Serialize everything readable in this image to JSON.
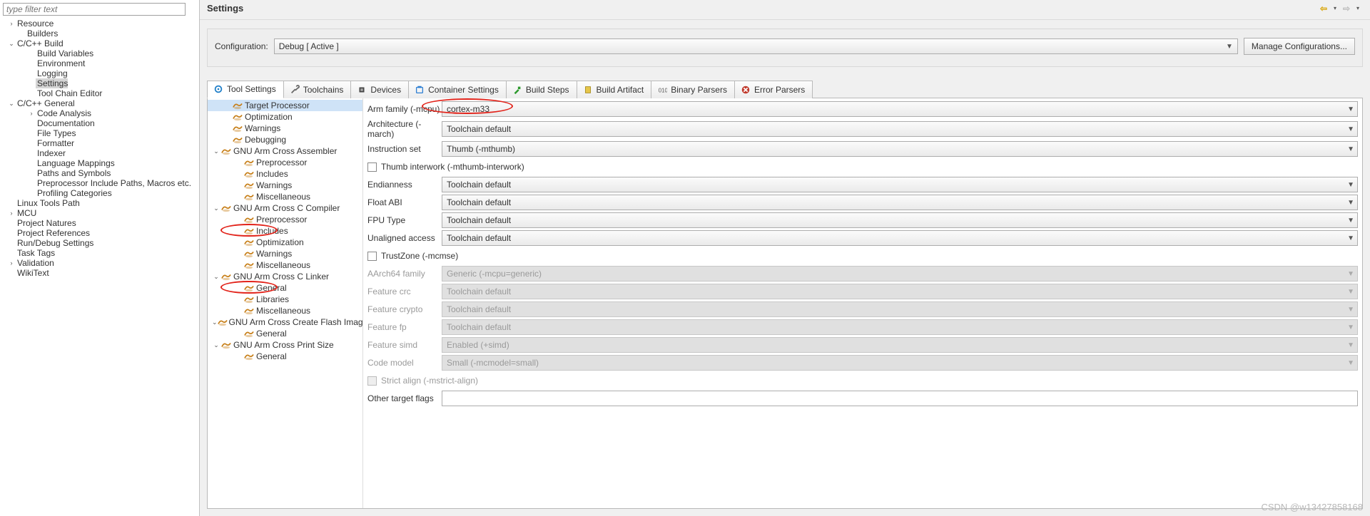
{
  "filter_placeholder": "type filter text",
  "nav": {
    "items": [
      {
        "label": "Resource",
        "indent": 0,
        "tw": ">"
      },
      {
        "label": "Builders",
        "indent": 1,
        "tw": ""
      },
      {
        "label": "C/C++ Build",
        "indent": 0,
        "tw": "v"
      },
      {
        "label": "Build Variables",
        "indent": 2,
        "tw": ""
      },
      {
        "label": "Environment",
        "indent": 2,
        "tw": ""
      },
      {
        "label": "Logging",
        "indent": 2,
        "tw": ""
      },
      {
        "label": "Settings",
        "indent": 2,
        "tw": "",
        "selected": true
      },
      {
        "label": "Tool Chain Editor",
        "indent": 2,
        "tw": ""
      },
      {
        "label": "C/C++ General",
        "indent": 0,
        "tw": "v"
      },
      {
        "label": "Code Analysis",
        "indent": 2,
        "tw": ">"
      },
      {
        "label": "Documentation",
        "indent": 2,
        "tw": ""
      },
      {
        "label": "File Types",
        "indent": 2,
        "tw": ""
      },
      {
        "label": "Formatter",
        "indent": 2,
        "tw": ""
      },
      {
        "label": "Indexer",
        "indent": 2,
        "tw": ""
      },
      {
        "label": "Language Mappings",
        "indent": 2,
        "tw": ""
      },
      {
        "label": "Paths and Symbols",
        "indent": 2,
        "tw": ""
      },
      {
        "label": "Preprocessor Include Paths, Macros etc.",
        "indent": 2,
        "tw": ""
      },
      {
        "label": "Profiling Categories",
        "indent": 2,
        "tw": ""
      },
      {
        "label": "Linux Tools Path",
        "indent": 0,
        "tw": ""
      },
      {
        "label": "MCU",
        "indent": 0,
        "tw": ">"
      },
      {
        "label": "Project Natures",
        "indent": 0,
        "tw": ""
      },
      {
        "label": "Project References",
        "indent": 0,
        "tw": ""
      },
      {
        "label": "Run/Debug Settings",
        "indent": 0,
        "tw": ""
      },
      {
        "label": "Task Tags",
        "indent": 0,
        "tw": ""
      },
      {
        "label": "Validation",
        "indent": 0,
        "tw": ">"
      },
      {
        "label": "WikiText",
        "indent": 0,
        "tw": ""
      }
    ]
  },
  "main": {
    "title": "Settings",
    "config_label": "Configuration:",
    "config_value": "Debug  [ Active ]",
    "manage_btn": "Manage Configurations..."
  },
  "tabs": [
    {
      "id": "tool-settings",
      "label": "Tool Settings",
      "icon": "gear",
      "active": true
    },
    {
      "id": "toolchains",
      "label": "Toolchains",
      "icon": "tools"
    },
    {
      "id": "devices",
      "label": "Devices",
      "icon": "chip"
    },
    {
      "id": "container-settings",
      "label": "Container Settings",
      "icon": "container"
    },
    {
      "id": "build-steps",
      "label": "Build Steps",
      "icon": "hammer"
    },
    {
      "id": "build-artifact",
      "label": "Build Artifact",
      "icon": "artifact"
    },
    {
      "id": "binary-parsers",
      "label": "Binary Parsers",
      "icon": "binary"
    },
    {
      "id": "error-parsers",
      "label": "Error Parsers",
      "icon": "error"
    }
  ],
  "tool_tree": [
    {
      "indent": 1,
      "tw": "",
      "sel": true,
      "label": "Target Processor"
    },
    {
      "indent": 1,
      "tw": "",
      "label": "Optimization"
    },
    {
      "indent": 1,
      "tw": "",
      "label": "Warnings"
    },
    {
      "indent": 1,
      "tw": "",
      "label": "Debugging"
    },
    {
      "indent": 0,
      "tw": "v",
      "label": "GNU Arm Cross Assembler"
    },
    {
      "indent": 2,
      "tw": "",
      "label": "Preprocessor"
    },
    {
      "indent": 2,
      "tw": "",
      "label": "Includes"
    },
    {
      "indent": 2,
      "tw": "",
      "label": "Warnings"
    },
    {
      "indent": 2,
      "tw": "",
      "label": "Miscellaneous"
    },
    {
      "indent": 0,
      "tw": "v",
      "label": "GNU Arm Cross C Compiler"
    },
    {
      "indent": 2,
      "tw": "",
      "label": "Preprocessor"
    },
    {
      "indent": 2,
      "tw": "",
      "label": "Includes",
      "circled": true
    },
    {
      "indent": 2,
      "tw": "",
      "label": "Optimization"
    },
    {
      "indent": 2,
      "tw": "",
      "label": "Warnings"
    },
    {
      "indent": 2,
      "tw": "",
      "label": "Miscellaneous"
    },
    {
      "indent": 0,
      "tw": "v",
      "label": "GNU Arm Cross C Linker"
    },
    {
      "indent": 2,
      "tw": "",
      "label": "General",
      "circled": true
    },
    {
      "indent": 2,
      "tw": "",
      "label": "Libraries"
    },
    {
      "indent": 2,
      "tw": "",
      "label": "Miscellaneous"
    },
    {
      "indent": 0,
      "tw": "v",
      "label": "GNU Arm Cross Create Flash Image"
    },
    {
      "indent": 2,
      "tw": "",
      "label": "General"
    },
    {
      "indent": 0,
      "tw": "v",
      "label": "GNU Arm Cross Print Size"
    },
    {
      "indent": 2,
      "tw": "",
      "label": "General"
    }
  ],
  "props": [
    {
      "type": "select",
      "label": "Arm family (-mcpu)",
      "value": "cortex-m33",
      "circled": true
    },
    {
      "type": "select",
      "label": "Architecture (-march)",
      "value": "Toolchain default"
    },
    {
      "type": "select",
      "label": "Instruction set",
      "value": "Thumb (-mthumb)"
    },
    {
      "type": "check",
      "label": "Thumb interwork (-mthumb-interwork)",
      "checked": false
    },
    {
      "type": "select",
      "label": "Endianness",
      "value": "Toolchain default"
    },
    {
      "type": "select",
      "label": "Float ABI",
      "value": "Toolchain default"
    },
    {
      "type": "select",
      "label": "FPU Type",
      "value": "Toolchain default"
    },
    {
      "type": "select",
      "label": "Unaligned access",
      "value": "Toolchain default"
    },
    {
      "type": "check",
      "label": "TrustZone (-mcmse)",
      "checked": false
    },
    {
      "type": "select",
      "label": "AArch64 family",
      "value": "Generic (-mcpu=generic)",
      "disabled": true
    },
    {
      "type": "select",
      "label": "Feature crc",
      "value": "Toolchain default",
      "disabled": true
    },
    {
      "type": "select",
      "label": "Feature crypto",
      "value": "Toolchain default",
      "disabled": true
    },
    {
      "type": "select",
      "label": "Feature fp",
      "value": "Toolchain default",
      "disabled": true
    },
    {
      "type": "select",
      "label": "Feature simd",
      "value": "Enabled (+simd)",
      "disabled": true
    },
    {
      "type": "select",
      "label": "Code model",
      "value": "Small (-mcmodel=small)",
      "disabled": true
    },
    {
      "type": "check",
      "label": "Strict align (-mstrict-align)",
      "checked": false,
      "disabled": true
    },
    {
      "type": "text",
      "label": "Other target flags",
      "value": ""
    }
  ],
  "watermark": "CSDN @w13427858168"
}
